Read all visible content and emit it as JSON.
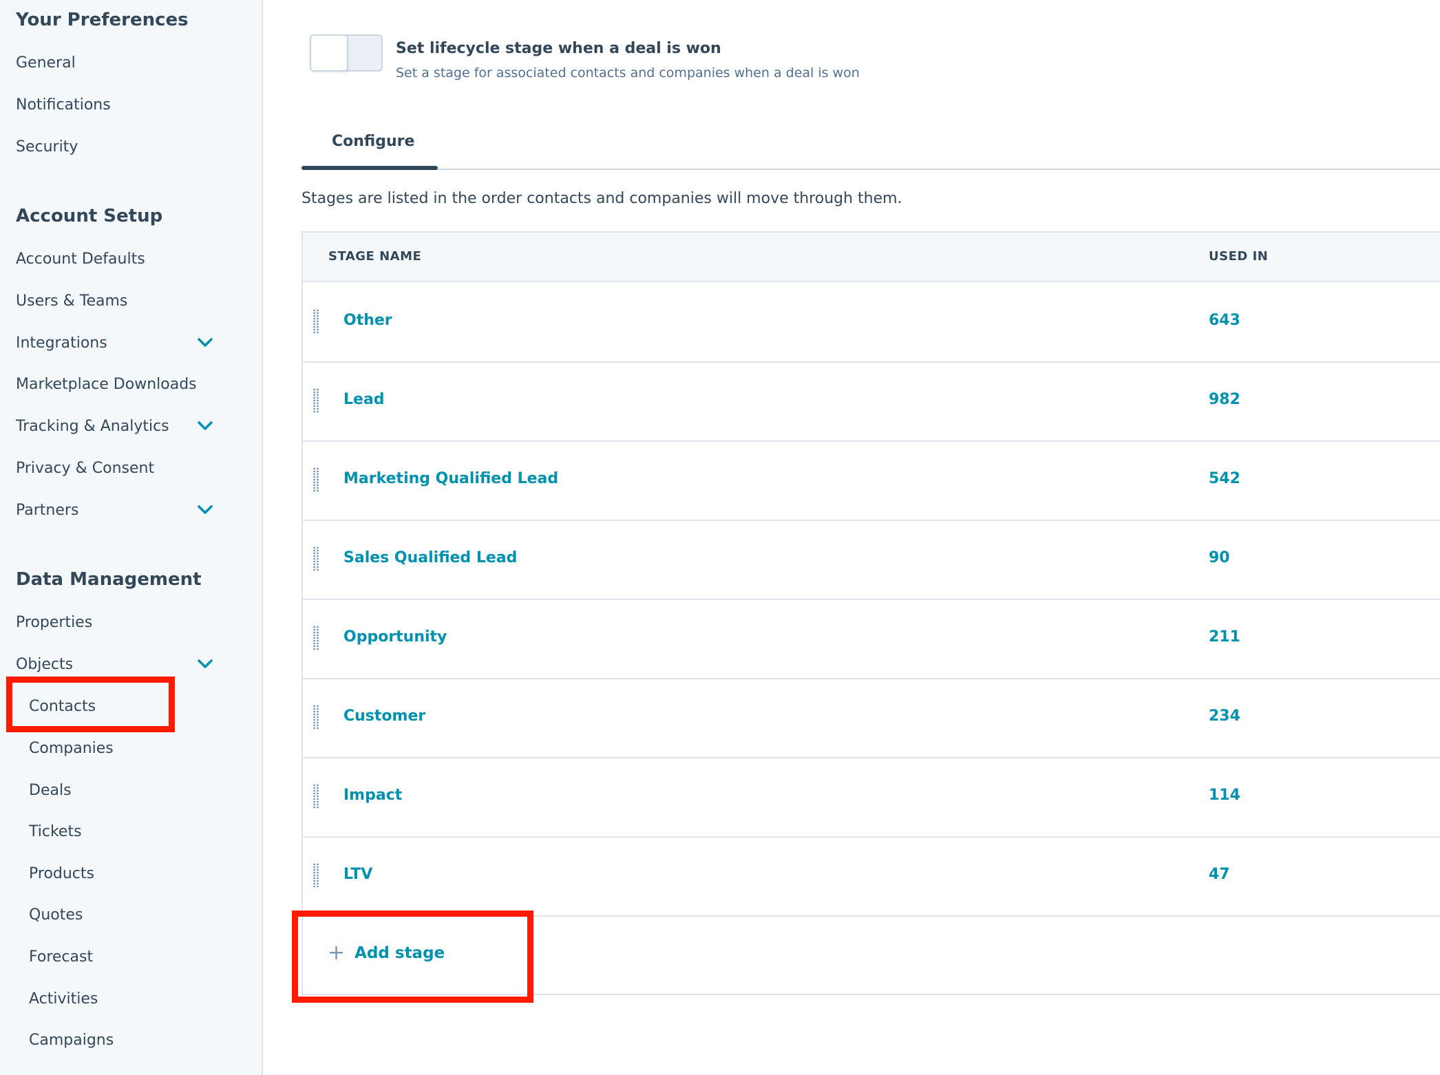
{
  "sidebar": {
    "sections": [
      {
        "title": "Your Preferences",
        "items": [
          {
            "label": "General"
          },
          {
            "label": "Notifications"
          },
          {
            "label": "Security"
          }
        ]
      },
      {
        "title": "Account Setup",
        "items": [
          {
            "label": "Account Defaults"
          },
          {
            "label": "Users & Teams"
          },
          {
            "label": "Integrations",
            "expandable": true
          },
          {
            "label": "Marketplace Downloads"
          },
          {
            "label": "Tracking & Analytics",
            "expandable": true
          },
          {
            "label": "Privacy & Consent"
          },
          {
            "label": "Partners",
            "expandable": true
          }
        ]
      },
      {
        "title": "Data Management",
        "items": [
          {
            "label": "Properties"
          },
          {
            "label": "Objects",
            "expandable": true,
            "expanded": true,
            "children": [
              {
                "label": "Contacts",
                "highlighted": true
              },
              {
                "label": "Companies"
              },
              {
                "label": "Deals"
              },
              {
                "label": "Tickets"
              },
              {
                "label": "Products"
              },
              {
                "label": "Quotes"
              },
              {
                "label": "Forecast"
              },
              {
                "label": "Activities"
              },
              {
                "label": "Campaigns"
              }
            ]
          }
        ]
      }
    ],
    "chevron_icon": "chevron-down-icon"
  },
  "setting": {
    "toggle_on": false,
    "title": "Set lifecycle stage when a deal is won",
    "description": "Set a stage for associated contacts and companies when a deal is won"
  },
  "tabs": [
    {
      "label": "Configure",
      "active": true
    }
  ],
  "intro_text": "Stages are listed in the order contacts and companies will move through them.",
  "table": {
    "columns": [
      "STAGE NAME",
      "USED IN"
    ],
    "rows": [
      {
        "name": "Other",
        "used_in": "643"
      },
      {
        "name": "Lead",
        "used_in": "982"
      },
      {
        "name": "Marketing Qualified Lead",
        "used_in": "542"
      },
      {
        "name": "Sales Qualified Lead",
        "used_in": "90"
      },
      {
        "name": "Opportunity",
        "used_in": "211"
      },
      {
        "name": "Customer",
        "used_in": "234"
      },
      {
        "name": "Impact",
        "used_in": "114"
      },
      {
        "name": "LTV",
        "used_in": "47"
      }
    ]
  },
  "add_stage": {
    "icon": "plus-icon",
    "label": "Add stage",
    "highlighted": true
  },
  "colors": {
    "accent": "#0091ae",
    "text": "#33475b",
    "highlight": "#ff1a00",
    "sidebar_bg": "#f5f8fa"
  }
}
